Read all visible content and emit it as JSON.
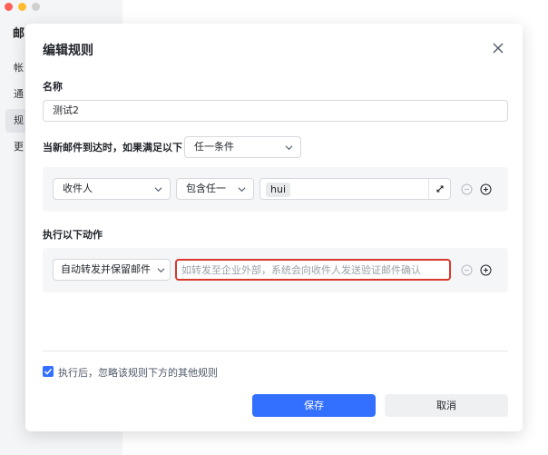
{
  "app": {
    "title": "邮",
    "nav": [
      "帐",
      "通",
      "规",
      "更"
    ]
  },
  "dialog": {
    "title": "编辑规则",
    "name_label": "名称",
    "name_value": "测试2",
    "condition_label": "当新邮件到达时，如果满足以下",
    "condition_mode": "任一条件",
    "condition": {
      "field": "收件人",
      "operator": "包含任一",
      "tag": "hui"
    },
    "action_label": "执行以下动作",
    "action": {
      "type": "自动转发并保留邮件",
      "placeholder": "如转发至企业外部，系统会向收件人发送验证邮件确认"
    },
    "skip_rules_label": "执行后，忽略该规则下方的其他规则",
    "save_label": "保存",
    "cancel_label": "取消"
  },
  "colors": {
    "primary": "#3370ff",
    "highlight_border": "#d9382c"
  }
}
